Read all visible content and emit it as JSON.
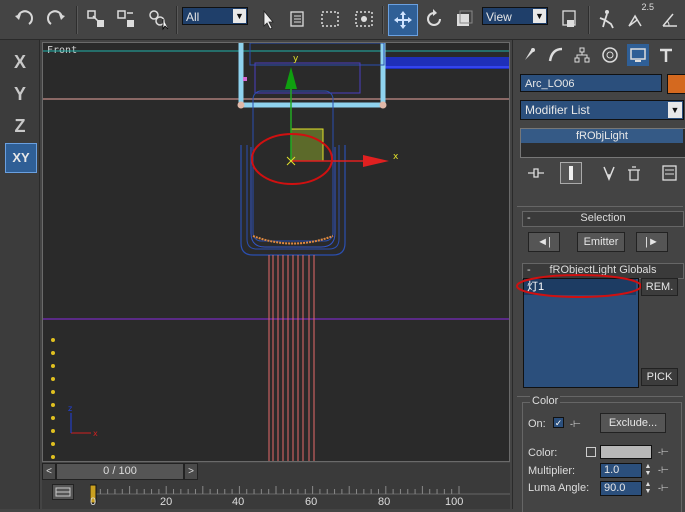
{
  "toolbar": {
    "filter_value": "All",
    "refcoord_value": "View",
    "snap_label": "2.5",
    "icons": [
      "undo-icon",
      "redo-icon",
      "link-icon",
      "unlink-icon",
      "bind-spacewarp-icon",
      "select-object-icon",
      "select-by-name-icon",
      "rect-region-icon",
      "window-crossing-icon",
      "move-icon",
      "rotate-icon",
      "scale-icon",
      "pivot-icon",
      "mirror-icon",
      "snap-icon",
      "angle-snap-icon"
    ]
  },
  "axisbar": {
    "x_label": "X",
    "y_label": "Y",
    "z_label": "Z",
    "xy_label": "XY"
  },
  "viewport": {
    "label": "Front",
    "gizmo_x": "x",
    "gizmo_y": "y",
    "triad_x": "x",
    "triad_z": "z"
  },
  "timeslider": {
    "label": "0 / 100",
    "prev": "<",
    "next": ">"
  },
  "trackbar": {
    "ticks": [
      "0",
      "20",
      "40",
      "60",
      "80",
      "100"
    ]
  },
  "panel": {
    "object_name": "Arc_LO06",
    "object_color": "#d4691f",
    "modifier_list": "Modifier List",
    "stack_item": "fRObjLight",
    "selection": {
      "title": "Selection",
      "prev": "◄|",
      "emitter": "Emitter",
      "next": "|►"
    },
    "globals": {
      "title": "fRObjectLight Globals",
      "list_items": [
        "灯1"
      ],
      "rem": "REM.",
      "pick": "PICK"
    },
    "color": {
      "title": "Color",
      "on_label": "On:",
      "on_checked": true,
      "exclude": "Exclude...",
      "color_label": "Color:",
      "multiplier_label": "Multiplier:",
      "multiplier_value": "1.0",
      "luma_label": "Luma Angle:",
      "luma_value": "90.0"
    }
  },
  "colors": {
    "accent": "#2f5f96",
    "annotation": "#d01010",
    "swatch": "#b8b8b8"
  }
}
